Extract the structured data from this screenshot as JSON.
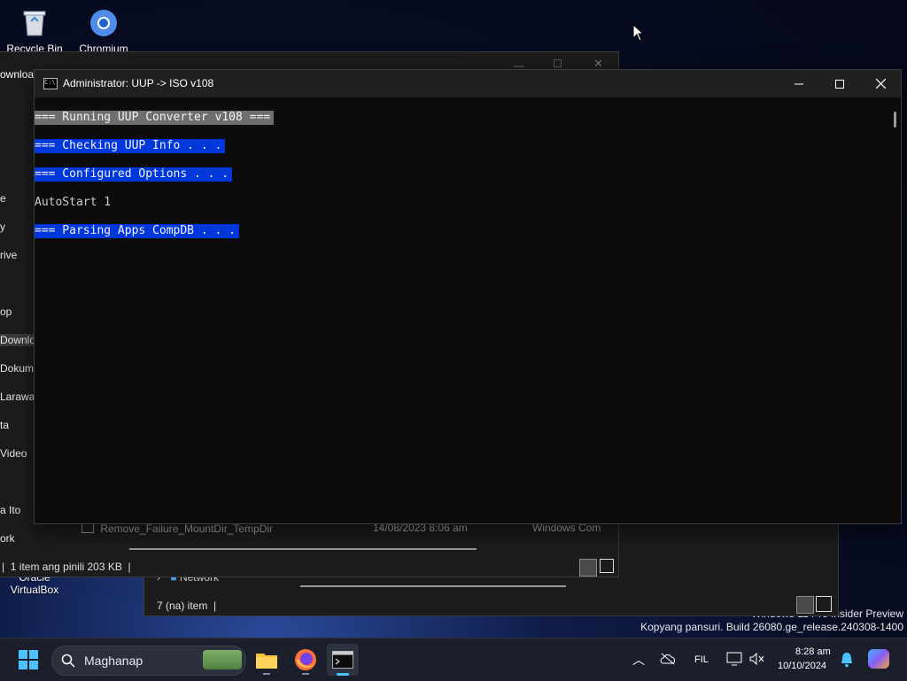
{
  "desktop": {
    "icons": [
      {
        "label": "Recycle Bin",
        "icon": "recycle-bin-icon"
      },
      {
        "label": "Chromium",
        "icon": "chromium-icon"
      },
      {
        "label": "Oracle VirtualBox",
        "line1": "Oracle",
        "line2": "VirtualBox",
        "icon": "virtualbox-icon"
      }
    ],
    "watermark": {
      "line1": "Windows 11 Pro Insider Preview",
      "line2": "Kopyang pansuri. Build 26080.ge_release.240308-1400"
    }
  },
  "explorer_back": {
    "title_partial": "ownload",
    "sidebar": [
      "e",
      "y",
      "rive",
      "op",
      "Downlo",
      "Dokume",
      "Larawa",
      "ta",
      "Video",
      "a Ito",
      "ork"
    ],
    "file_row": {
      "name": "Remove_Failure_MountDir_TempDir",
      "date": "14/08/2023 8:06 am",
      "type": "Windows Com"
    },
    "status": "1 item ang pinili  203 KB"
  },
  "explorer_back2": {
    "network_label": "Network",
    "status": "7 (na) item"
  },
  "console": {
    "title": "Administrator:  UUP -> ISO v108",
    "lines": [
      {
        "text": "=== Running UUP Converter v108 ===",
        "style": "gray"
      },
      {
        "text": "=== Checking UUP Info . . .",
        "style": "blue"
      },
      {
        "text": "=== Configured Options . . .",
        "style": "blue"
      },
      {
        "text": "AutoStart 1",
        "style": "plain"
      },
      {
        "text": "=== Parsing Apps CompDB . . .",
        "style": "blue"
      }
    ]
  },
  "taskbar": {
    "search_placeholder": "Maghanap",
    "language": "FIL",
    "time": "8:28 am",
    "date": "10/10/2024",
    "apps": [
      "start-icon",
      "file-explorer-icon",
      "firefox-icon",
      "terminal-icon"
    ]
  }
}
